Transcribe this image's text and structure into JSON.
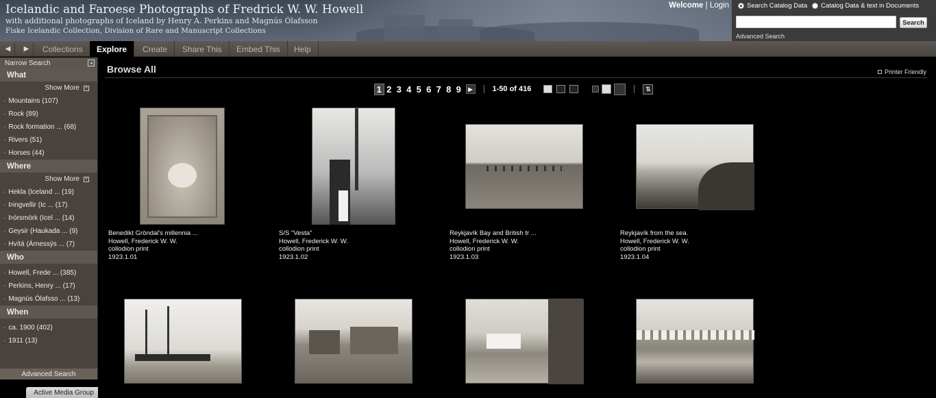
{
  "header": {
    "title": "Icelandic and Faroese Photographs of Fredrick W. W. Howell",
    "subtitle": "with additional photographs of Iceland by Henry A. Perkins and Magnús Ólafsson",
    "subtitle2": "Fiske Icelandic Collection, Division of Rare and Manuscript Collections",
    "welcome": "Welcome",
    "divider": "|",
    "login": "Login"
  },
  "search": {
    "option_catalog": "Search Catalog Data",
    "option_documents": "Catalog Data & text in Documents",
    "input_value": "",
    "button": "Search",
    "advanced": "Advanced Search"
  },
  "nav": {
    "tabs": [
      "Collections",
      "Explore",
      "Create",
      "Share This",
      "Embed This",
      "Help"
    ],
    "active_tab": "Explore"
  },
  "sidebar": {
    "header": "Narrow Search",
    "show_more": "Show More",
    "facets": {
      "what": {
        "title": "What",
        "items": [
          "Mountains (107)",
          "Rock (89)",
          "Rock formation ... (68)",
          "Rivers (51)",
          "Horses (44)"
        ]
      },
      "where": {
        "title": "Where",
        "items": [
          "Hekla (Iceland ... (19)",
          "Þingvellir (Ic ... (17)",
          "Þórsmörk (Icel ... (14)",
          "Geysir (Haukada ... (9)",
          "Hvítá (Árnessýs ... (7)"
        ]
      },
      "who": {
        "title": "Who",
        "items": [
          "Howell, Frede ... (385)",
          "Perkins, Henry ... (17)",
          "Magnús Ólafsso ... (13)"
        ]
      },
      "when": {
        "title": "When",
        "items": [
          "ca. 1900 (402)",
          "1911 (13)"
        ]
      }
    },
    "advanced": "Advanced Search"
  },
  "active_media": "Active Media Group",
  "main": {
    "title": "Browse All",
    "printer": "Printer Friendly",
    "pages": [
      "1",
      "2",
      "3",
      "4",
      "5",
      "6",
      "7",
      "8",
      "9"
    ],
    "current_page": "1",
    "count": "1-50 of 416"
  },
  "items": [
    {
      "title": "Benedikt Gröndal's millennia ...",
      "creator": "Howell, Frederick W. W.",
      "format": "collodion print",
      "id": "1923.1.01"
    },
    {
      "title": "S/S \"Vesta\"",
      "creator": "Howell, Frederick W. W.",
      "format": "collodion print",
      "id": "1923.1.02"
    },
    {
      "title": "Reykjavík Bay and British tr ...",
      "creator": "Howell, Frederick W. W.",
      "format": "collodion print",
      "id": "1923.1.03"
    },
    {
      "title": "Reykjavík from the sea.",
      "creator": "Howell, Frederick W. W.",
      "format": "collodion print",
      "id": "1923.1.04"
    }
  ]
}
